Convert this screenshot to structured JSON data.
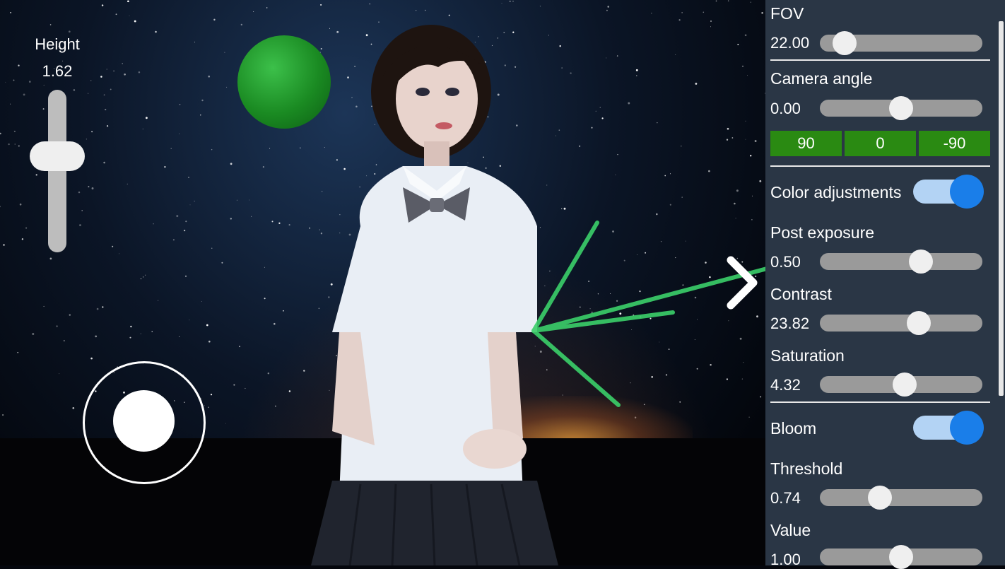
{
  "height_control": {
    "label": "Height",
    "value": "1.62",
    "level": 0.57
  },
  "joystick": {
    "icon": "joystick-icon"
  },
  "scene": {
    "ball_color": "#1f8f27",
    "ray_color": "#3bd06a"
  },
  "nav": {
    "icon": "chevron-right-icon"
  },
  "panel": {
    "fov": {
      "label": "FOV",
      "value": "22.00",
      "level": 0.15
    },
    "camera_angle": {
      "label": "Camera angle",
      "value": "0.00",
      "level": 0.5
    },
    "angle_buttons": [
      "90",
      "0",
      "-90"
    ],
    "color_adjustments": {
      "label": "Color adjustments",
      "on": true
    },
    "post_exposure": {
      "label": "Post exposure",
      "value": "0.50",
      "level": 0.62
    },
    "contrast": {
      "label": "Contrast",
      "value": "23.82",
      "level": 0.61
    },
    "saturation": {
      "label": "Saturation",
      "value": "4.32",
      "level": 0.52
    },
    "bloom": {
      "label": "Bloom",
      "on": true
    },
    "threshold": {
      "label": "Threshold",
      "value": "0.74",
      "level": 0.37
    },
    "value": {
      "label": "Value",
      "value": "1.00",
      "level": 0.5
    }
  },
  "colors": {
    "panel_bg": "#2a3645",
    "accent": "#1a7ee9",
    "button_green": "#2a8a12"
  }
}
